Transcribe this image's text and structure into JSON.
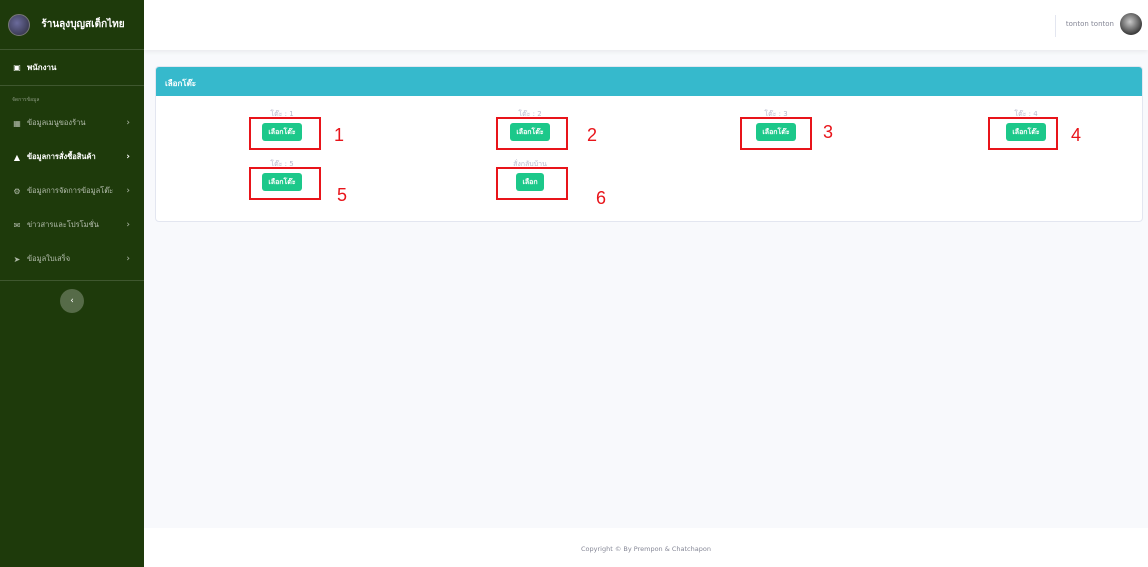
{
  "sidebar": {
    "brand": "ร้านลุงบุญสเต็กไทย",
    "top_item": "พนักงาน",
    "heading": "จัดการข้อมูล",
    "items": [
      {
        "label": "ข้อมูลเมนูของร้าน",
        "icon": "table-icon"
      },
      {
        "label": "ข้อมูลการสั่งซื้อสินค้า",
        "icon": "bag-icon"
      },
      {
        "label": "ข้อมูลการจัดการข้อมูลโต๊ะ",
        "icon": "settings-icon"
      },
      {
        "label": "ข่าวสารและโปรโมชั่น",
        "icon": "megaphone-icon"
      },
      {
        "label": "ข้อมูลใบเสร็จ",
        "icon": "send-icon"
      }
    ]
  },
  "topbar": {
    "user_name": "tonton tonton"
  },
  "card": {
    "header": "เลือกโต๊ะ",
    "slots": [
      {
        "label": "โต๊ะ : 1",
        "button": "เลือกโต๊ะ",
        "marker": "1"
      },
      {
        "label": "โต๊ะ : 2",
        "button": "เลือกโต๊ะ",
        "marker": "2"
      },
      {
        "label": "โต๊ะ : 3",
        "button": "เลือกโต๊ะ",
        "marker": "3"
      },
      {
        "label": "โต๊ะ : 4",
        "button": "เลือกโต๊ะ",
        "marker": "4"
      },
      {
        "label": "โต๊ะ : 5",
        "button": "เลือกโต๊ะ",
        "marker": "5"
      },
      {
        "label": "สั่งกลับบ้าน",
        "button": "เลือก",
        "marker": "6"
      }
    ]
  },
  "footer": {
    "copyright": "Copyright © By Prempon & Chatchapon"
  },
  "colors": {
    "sidebar": "#1e3a0b",
    "header": "#36b9cc",
    "button": "#1cc88a",
    "marker": "#e8141a"
  }
}
